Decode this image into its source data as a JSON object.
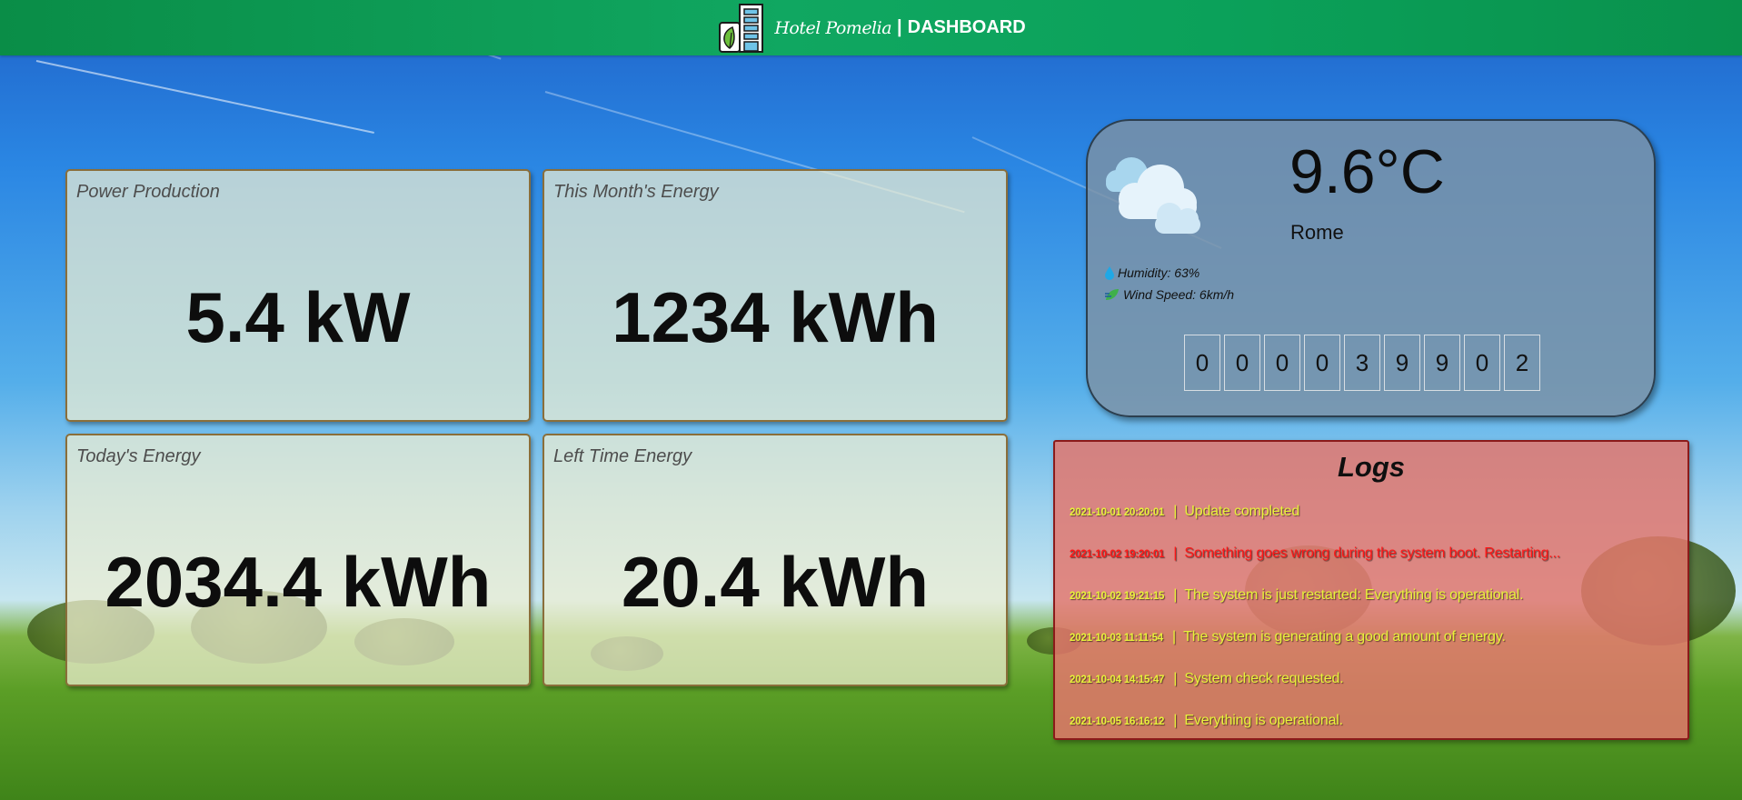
{
  "header": {
    "brand_name": "Hotel Pomelia",
    "separator": "|",
    "title": "DASHBOARD",
    "logo_icon": "hotel-building-leaf-icon"
  },
  "cards": [
    {
      "title": "Power Production",
      "value": "5.4 kW"
    },
    {
      "title": "This Month's Energy",
      "value": "1234 kWh"
    },
    {
      "title": "Today's Energy",
      "value": "2034.4 kWh"
    },
    {
      "title": "Left Time Energy",
      "value": "20.4 kWh"
    }
  ],
  "weather": {
    "icon": "cloudy-icon",
    "temperature": "9.6°C",
    "city": "Rome",
    "humidity": "Humidity: 63%",
    "wind": "Wind Speed: 6km/h",
    "counter_digits": [
      "0",
      "0",
      "0",
      "0",
      "3",
      "9",
      "9",
      "0",
      "2"
    ]
  },
  "logs": {
    "title": "Logs",
    "entries": [
      {
        "time": "2021-10-01 20:20:01",
        "sep": "|",
        "message": "Update completed",
        "level": "ok"
      },
      {
        "time": "2021-10-02 19:20:01",
        "sep": "|",
        "message": "Something goes wrong during the system boot. Restarting...",
        "level": "error"
      },
      {
        "time": "2021-10-02 19:21:15",
        "sep": "|",
        "message": "The system is just restarted: Everything is operational.",
        "level": "ok"
      },
      {
        "time": "2021-10-03 11:11:54",
        "sep": "|",
        "message": "The system is generating a good amount of energy.",
        "level": "ok"
      },
      {
        "time": "2021-10-04 14:15:47",
        "sep": "|",
        "message": "System check requested.",
        "level": "ok"
      },
      {
        "time": "2021-10-05 16:16:12",
        "sep": "|",
        "message": "Everything is operational.",
        "level": "ok"
      }
    ]
  },
  "colors": {
    "header_green": "#10a761",
    "log_ok": "#e8f23a",
    "log_error": "#ff1717",
    "logs_background": "#e4766c",
    "weather_background": "#7d91a5"
  }
}
